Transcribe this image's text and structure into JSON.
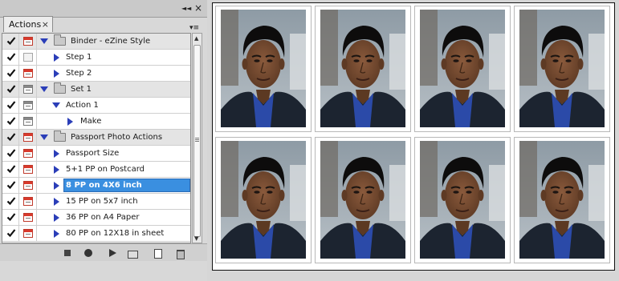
{
  "panel": {
    "tab_label": "Actions",
    "tab_close": "×",
    "collapse_glyph": "◄◄",
    "close_glyph": "×",
    "menu_glyph": "▾≡",
    "rows": [
      {
        "kind": "set",
        "label": "Binder - eZine Style",
        "checked": true,
        "dialog": "red"
      },
      {
        "kind": "action",
        "label": "Step 1",
        "checked": true,
        "dialog": "empty"
      },
      {
        "kind": "action",
        "label": "Step 2",
        "checked": true,
        "dialog": "red"
      },
      {
        "kind": "set",
        "label": "Set 1",
        "checked": true,
        "dialog": "gray"
      },
      {
        "kind": "action",
        "label": "Action 1",
        "checked": true,
        "dialog": "gray",
        "expanded": true
      },
      {
        "kind": "step",
        "label": "Make",
        "checked": true,
        "dialog": "gray"
      },
      {
        "kind": "set",
        "label": "Passport Photo Actions",
        "checked": true,
        "dialog": "red"
      },
      {
        "kind": "action",
        "label": "Passport Size",
        "checked": true,
        "dialog": "red"
      },
      {
        "kind": "action",
        "label": "5+1 PP on Postcard",
        "checked": true,
        "dialog": "red"
      },
      {
        "kind": "action",
        "label": "8 PP on 4X6 inch",
        "checked": true,
        "dialog": "red",
        "selected": true
      },
      {
        "kind": "action",
        "label": "15 PP on 5x7 inch",
        "checked": true,
        "dialog": "red"
      },
      {
        "kind": "action",
        "label": "36 PP on A4 Paper",
        "checked": true,
        "dialog": "red"
      },
      {
        "kind": "action",
        "label": "80 PP on 12X18 in sheet",
        "checked": true,
        "dialog": "red"
      }
    ],
    "bottom_buttons": [
      "stop-icon",
      "record-icon",
      "play-icon",
      "new-set-icon",
      "new-action-icon",
      "trash-icon"
    ]
  },
  "sheet": {
    "rows": 2,
    "cols": 4,
    "photo_count": 8
  },
  "colors": {
    "selection": "#3a8fe0",
    "disclosure_triangle": "#2b3eb8",
    "dialog_red": "#d83a2d"
  }
}
